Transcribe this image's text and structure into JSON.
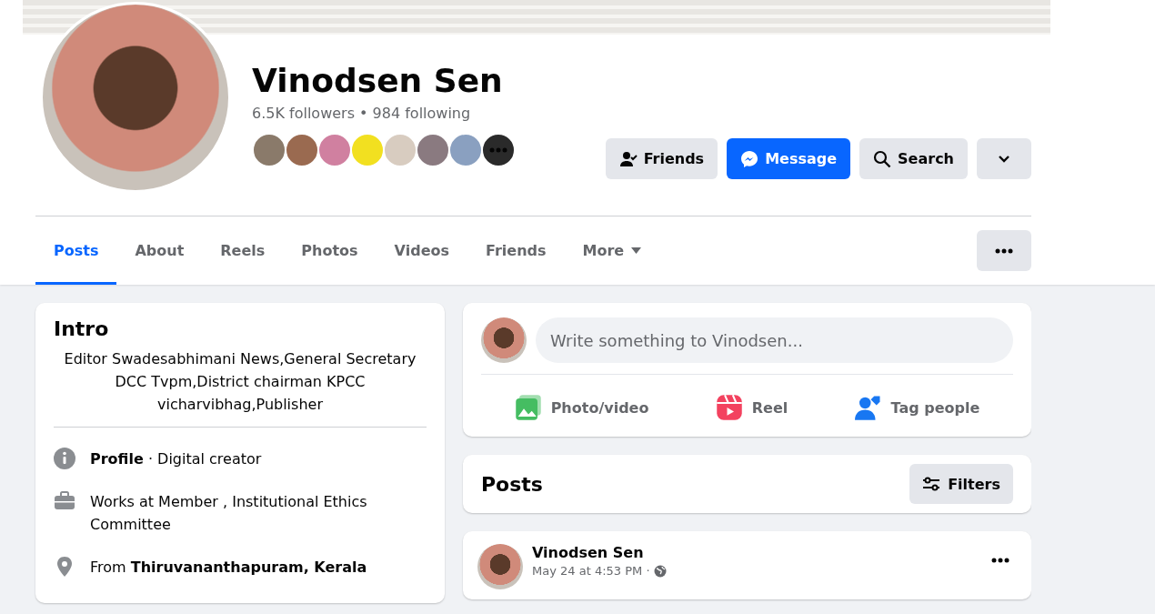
{
  "profile": {
    "name": "Vinodsen Sen",
    "stats": "6.5K followers • 984 following"
  },
  "actions": [
    {
      "kind": "friends",
      "label": "Friends"
    },
    {
      "kind": "message",
      "label": "Message"
    },
    {
      "kind": "search",
      "label": "Search"
    },
    {
      "kind": "dropdown"
    }
  ],
  "tabs": [
    {
      "label": "Posts",
      "selected": true,
      "kind": "link"
    },
    {
      "label": "About",
      "selected": false,
      "kind": "link"
    },
    {
      "label": "Reels",
      "selected": false,
      "kind": "link"
    },
    {
      "label": "Photos",
      "selected": false,
      "kind": "link"
    },
    {
      "label": "Videos",
      "selected": false,
      "kind": "link"
    },
    {
      "label": "Friends",
      "selected": false,
      "kind": "link"
    },
    {
      "label": "More",
      "selected": false,
      "kind": "menu"
    }
  ],
  "intro": {
    "title": "Intro",
    "bio": "Editor Swadesabhimani News,General Secretary DCC Tvpm,District chairman KPCC vicharvibhag,Publisher",
    "items": [
      {
        "kind": "info",
        "text": "**Profile** · Digital creator"
      },
      {
        "kind": "work",
        "text": "Works at Member , Institutional Ethics Committee"
      },
      {
        "kind": "location",
        "text": "From **Thiruvananthapuram, Kerala**"
      }
    ]
  },
  "composer": {
    "placeholder": "Write something to Vinodsen...",
    "actions": [
      {
        "kind": "photo",
        "label": "Photo/video"
      },
      {
        "kind": "reel",
        "label": "Reel"
      },
      {
        "kind": "tag",
        "label": "Tag people"
      }
    ]
  },
  "posts": {
    "title": "Posts",
    "filters": "Filters"
  },
  "post": {
    "author": "Vinodsen Sen",
    "time": "May 24 at 4:53 PM ·"
  }
}
